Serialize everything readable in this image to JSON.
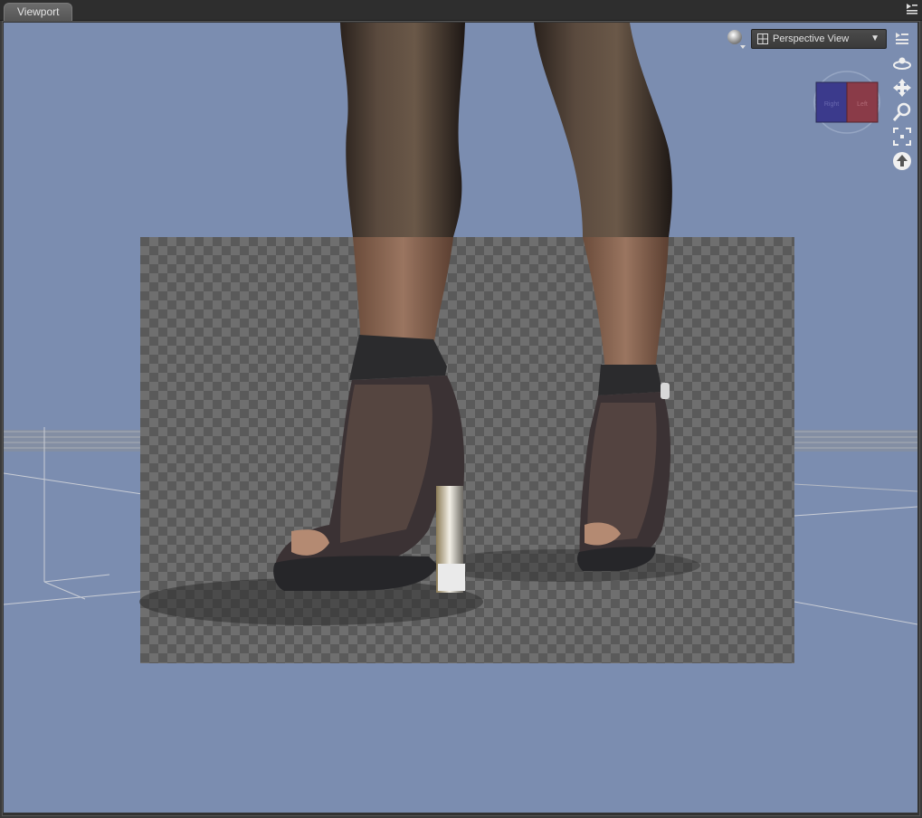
{
  "panel": {
    "tab_label": "Viewport",
    "menu_icon": "panel-menu-icon"
  },
  "viewport": {
    "background_color": "#7b8db0",
    "camera_dropdown": {
      "selected": "Perspective View",
      "icon": "grid-icon"
    },
    "draw_style_icon": "sphere-shading-icon",
    "nav_cube": {
      "left_face_label": "Right",
      "right_face_label": "Left"
    },
    "tools": [
      {
        "name": "viewport-options-icon"
      },
      {
        "name": "orbit-icon"
      },
      {
        "name": "pan-icon"
      },
      {
        "name": "zoom-icon"
      },
      {
        "name": "frame-icon"
      },
      {
        "name": "home-icon"
      }
    ]
  }
}
